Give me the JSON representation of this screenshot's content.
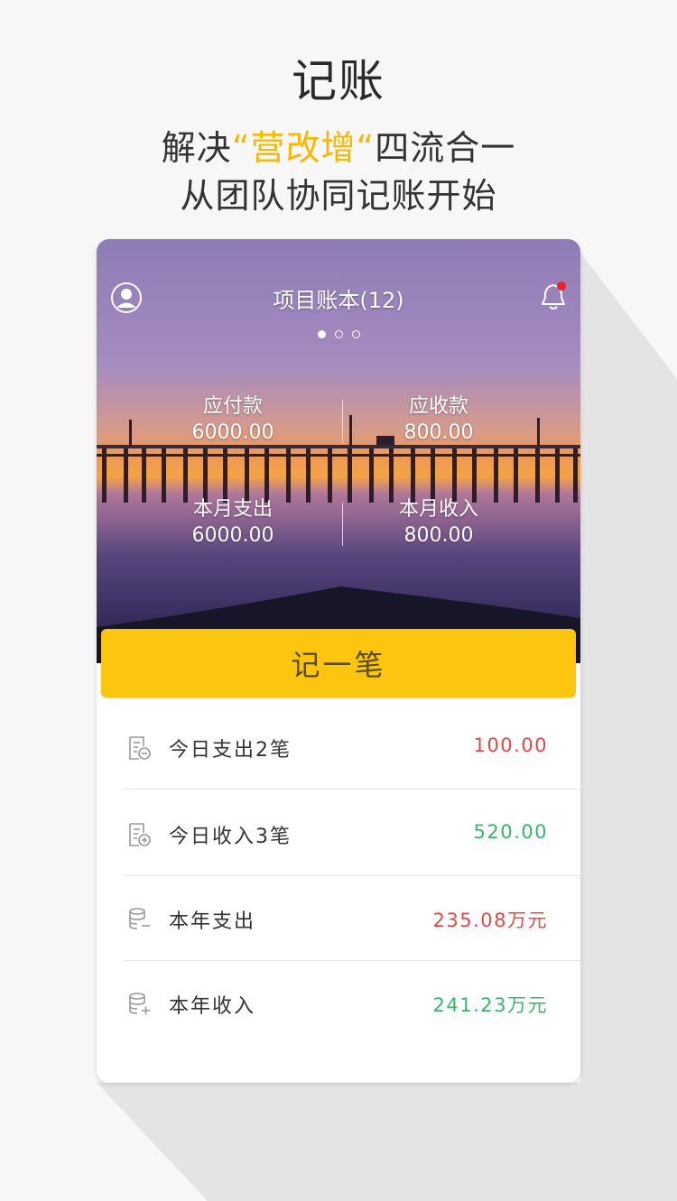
{
  "promo": {
    "title": "记账",
    "line1_pre": "解决",
    "line1_highlight": "“营改增“",
    "line1_post": "四流合一",
    "line2": "从团队协同记账开始"
  },
  "header": {
    "title": "项目账本(12)",
    "left_icon": "user-icon",
    "right_icon": "bell-icon",
    "notification_dot_color": "#e8232a",
    "carousel_pages": 3,
    "carousel_active": 0
  },
  "stats": {
    "payable_label": "应付款",
    "payable_value": "6000.00",
    "receivable_label": "应收款",
    "receivable_value": "800.00",
    "month_expense_label": "本月支出",
    "month_expense_value": "6000.00",
    "month_income_label": "本月收入",
    "month_income_value": "800.00"
  },
  "record_button": {
    "label": "记一笔",
    "color": "#fcc50f"
  },
  "summary": [
    {
      "label": "今日支出2笔",
      "amount": "100.00",
      "type": "expense",
      "icon": "receipt-minus-icon"
    },
    {
      "label": "今日收入3笔",
      "amount": "520.00",
      "type": "income",
      "icon": "receipt-plus-icon"
    },
    {
      "label": "本年支出",
      "amount": "235.08万元",
      "type": "expense",
      "icon": "coins-minus-icon"
    },
    {
      "label": "本年收入",
      "amount": "241.23万元",
      "type": "income",
      "icon": "coins-plus-icon"
    }
  ],
  "colors": {
    "expense": "#e0494a",
    "income": "#39b56b",
    "highlight": "#f6b800"
  }
}
